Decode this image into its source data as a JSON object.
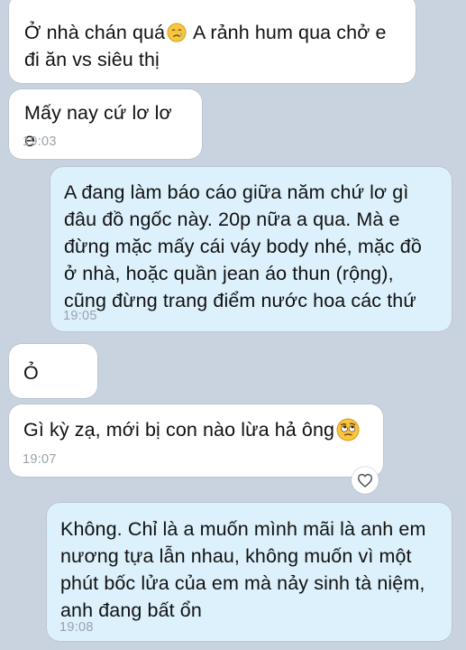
{
  "colors": {
    "background": "#c9d3df",
    "incoming_bubble": "#ffffff",
    "outgoing_bubble": "#ddf1fc",
    "timestamp": "#9aa2ab"
  },
  "messages": [
    {
      "direction": "incoming",
      "text_before": "Ở nhà chán quá",
      "emoji_name": "crying-face-icon",
      "text_after": " A rảnh hum qua chở e đi ăn vs siêu thị",
      "time": ""
    },
    {
      "direction": "incoming",
      "text": "Mấy nay cứ lơ lơ e",
      "time": "19:03"
    },
    {
      "direction": "outgoing",
      "text": "A đang làm báo cáo giữa năm chứ lơ gì đâu đồ ngốc này. 20p nữa a qua. Mà e đừng mặc mấy cái váy body nhé, mặc đồ ở nhà, hoặc quần jean áo thun (rộng), cũng đừng trang điểm nước hoa các thứ",
      "time": "19:05"
    },
    {
      "direction": "incoming",
      "text": "Ỏ",
      "time": ""
    },
    {
      "direction": "incoming",
      "text": "Gì kỳ zạ, mới bị con nào lừa hả ông",
      "emoji_name": "face-with-rolling-eyes-icon",
      "time": "19:07",
      "reaction_icon": "heart-outline-icon"
    },
    {
      "direction": "outgoing",
      "text": "Không. Chỉ là a muốn mình mãi là anh em nương tựa lẫn nhau, không muốn vì một phút bốc lửa của em mà nảy sinh tà niệm, anh đang bất ổn",
      "time": "19:08"
    }
  ]
}
